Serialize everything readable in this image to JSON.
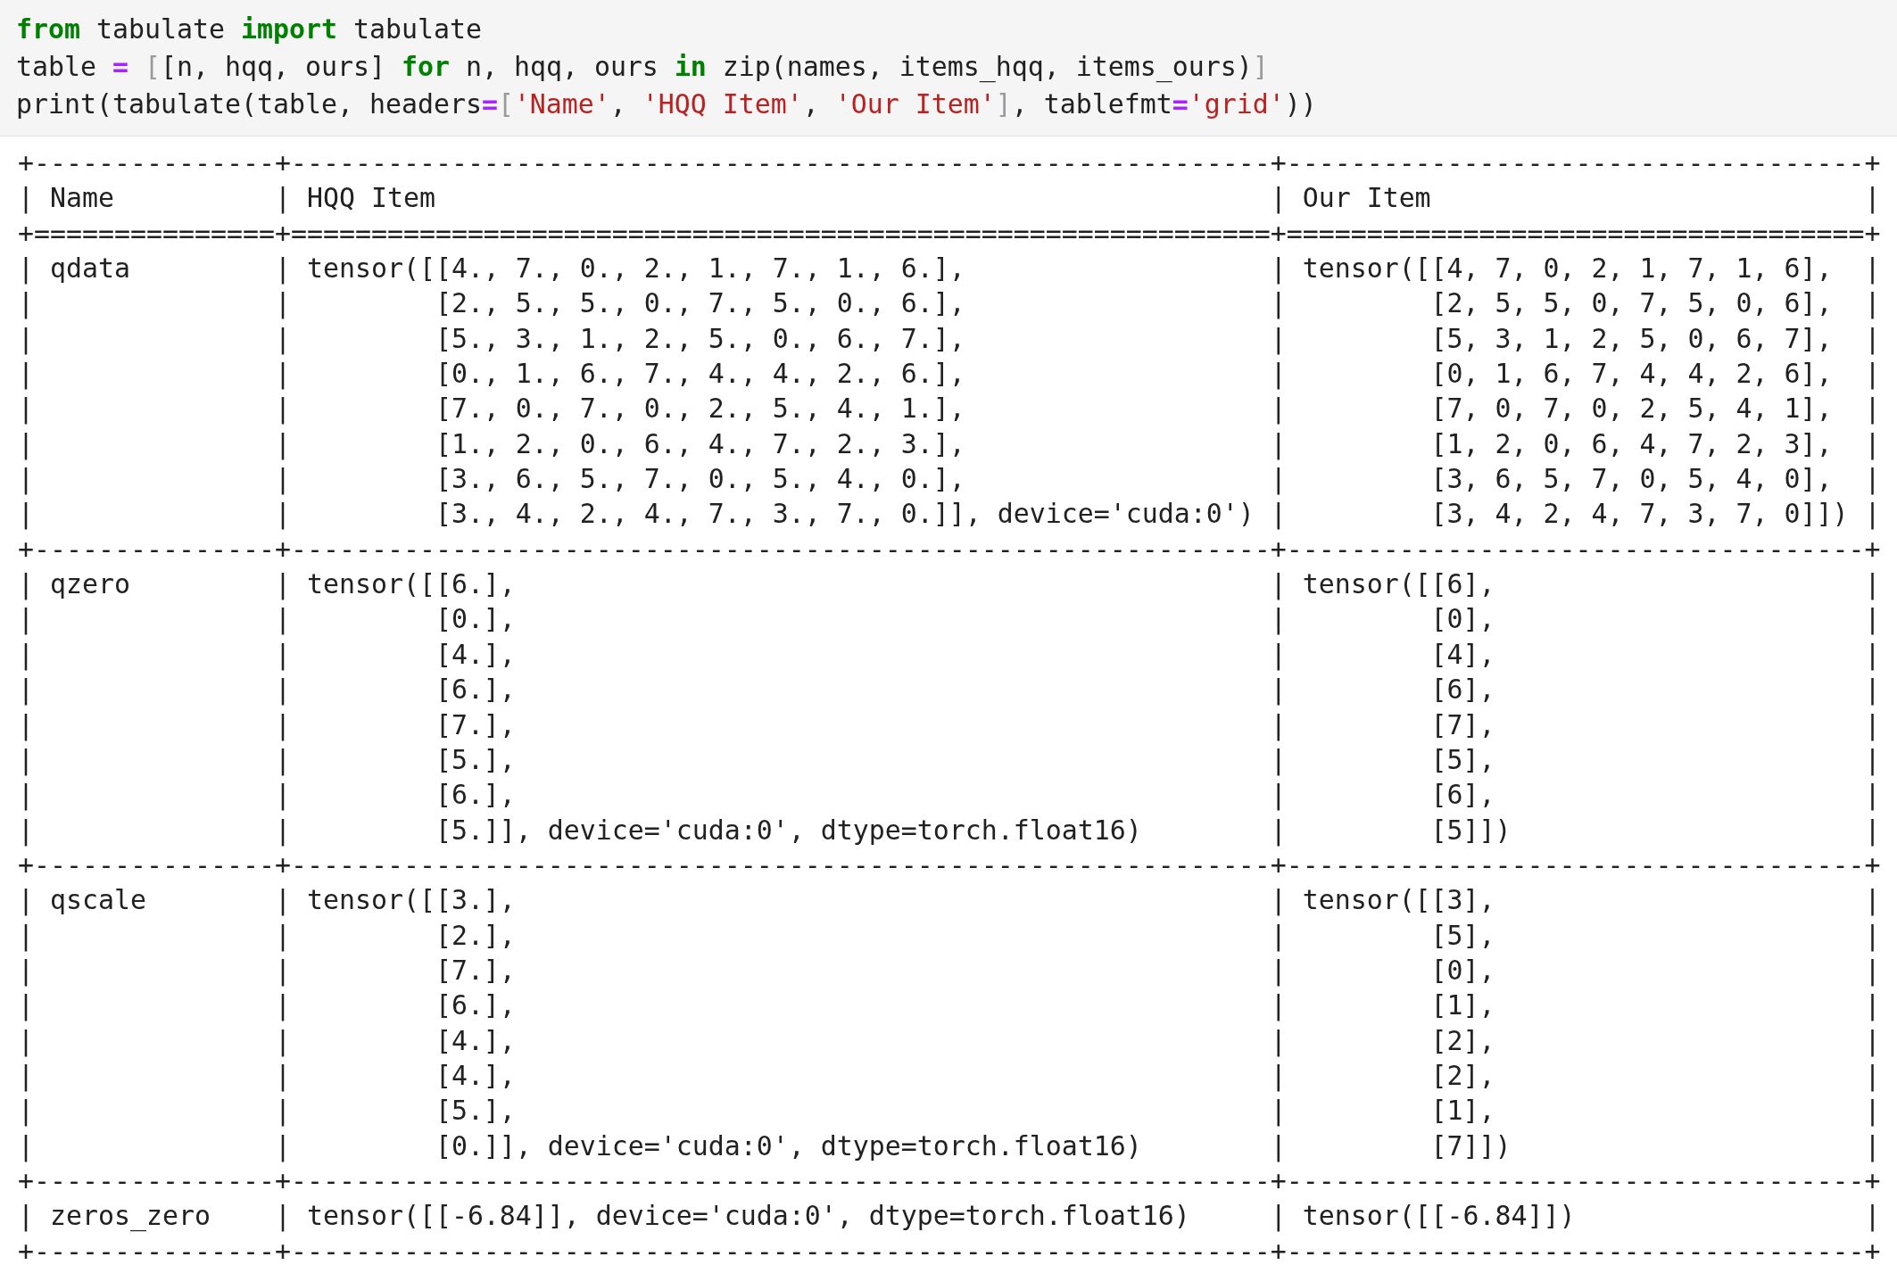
{
  "code_cell": {
    "lines": [
      [
        {
          "kind": "keyword",
          "text": "from"
        },
        {
          "kind": "plain",
          "text": " tabulate "
        },
        {
          "kind": "keyword",
          "text": "import"
        },
        {
          "kind": "plain",
          "text": " tabulate"
        }
      ],
      [
        {
          "kind": "plain",
          "text": "table "
        },
        {
          "kind": "operator",
          "text": "= "
        },
        {
          "kind": "bracket",
          "text": "["
        },
        {
          "kind": "plain",
          "text": "[n, hqq, ours] "
        },
        {
          "kind": "keyword",
          "text": "for"
        },
        {
          "kind": "plain",
          "text": " n, hqq, ours "
        },
        {
          "kind": "keyword",
          "text": "in"
        },
        {
          "kind": "plain",
          "text": " zip(names, items_hqq, items_ours)"
        },
        {
          "kind": "bracket",
          "text": "]"
        }
      ],
      [
        {
          "kind": "plain",
          "text": "print(tabulate(table, headers"
        },
        {
          "kind": "operator",
          "text": "="
        },
        {
          "kind": "bracket",
          "text": "["
        },
        {
          "kind": "string",
          "text": "'Name'"
        },
        {
          "kind": "plain",
          "text": ", "
        },
        {
          "kind": "string",
          "text": "'HQQ Item'"
        },
        {
          "kind": "plain",
          "text": ", "
        },
        {
          "kind": "string",
          "text": "'Our Item'"
        },
        {
          "kind": "bracket",
          "text": "]"
        },
        {
          "kind": "plain",
          "text": ", tablefmt"
        },
        {
          "kind": "operator",
          "text": "="
        },
        {
          "kind": "string",
          "text": "'grid'"
        },
        {
          "kind": "plain",
          "text": "))"
        }
      ]
    ]
  },
  "output": {
    "lines": [
      "+---------------+-------------------------------------------------------------+------------------------------------+",
      "| Name          | HQQ Item                                                    | Our Item                           |",
      "+===============+=============================================================+====================================+",
      "| qdata         | tensor([[4., 7., 0., 2., 1., 7., 1., 6.],                   | tensor([[4, 7, 0, 2, 1, 7, 1, 6],  |",
      "|               |         [2., 5., 5., 0., 7., 5., 0., 6.],                   |         [2, 5, 5, 0, 7, 5, 0, 6],  |",
      "|               |         [5., 3., 1., 2., 5., 0., 6., 7.],                   |         [5, 3, 1, 2, 5, 0, 6, 7],  |",
      "|               |         [0., 1., 6., 7., 4., 4., 2., 6.],                   |         [0, 1, 6, 7, 4, 4, 2, 6],  |",
      "|               |         [7., 0., 7., 0., 2., 5., 4., 1.],                   |         [7, 0, 7, 0, 2, 5, 4, 1],  |",
      "|               |         [1., 2., 0., 6., 4., 7., 2., 3.],                   |         [1, 2, 0, 6, 4, 7, 2, 3],  |",
      "|               |         [3., 6., 5., 7., 0., 5., 4., 0.],                   |         [3, 6, 5, 7, 0, 5, 4, 0],  |",
      "|               |         [3., 4., 2., 4., 7., 3., 7., 0.]], device='cuda:0') |         [3, 4, 2, 4, 7, 3, 7, 0]]) |",
      "+---------------+-------------------------------------------------------------+------------------------------------+",
      "| qzero         | tensor([[6.],                                               | tensor([[6],                       |",
      "|               |         [0.],                                               |         [0],                       |",
      "|               |         [4.],                                               |         [4],                       |",
      "|               |         [6.],                                               |         [6],                       |",
      "|               |         [7.],                                               |         [7],                       |",
      "|               |         [5.],                                               |         [5],                       |",
      "|               |         [6.],                                               |         [6],                       |",
      "|               |         [5.]], device='cuda:0', dtype=torch.float16)        |         [5]])                      |",
      "+---------------+-------------------------------------------------------------+------------------------------------+",
      "| qscale        | tensor([[3.],                                               | tensor([[3],                       |",
      "|               |         [2.],                                               |         [5],                       |",
      "|               |         [7.],                                               |         [0],                       |",
      "|               |         [6.],                                               |         [1],                       |",
      "|               |         [4.],                                               |         [2],                       |",
      "|               |         [4.],                                               |         [2],                       |",
      "|               |         [5.],                                               |         [1],                       |",
      "|               |         [0.]], device='cuda:0', dtype=torch.float16)        |         [7]])                      |",
      "+---------------+-------------------------------------------------------------+------------------------------------+",
      "| zeros_zero    | tensor([[-6.84]], device='cuda:0', dtype=torch.float16)     | tensor([[-6.84]])                  |",
      "+---------------+-------------------------------------------------------------+------------------------------------+"
    ]
  }
}
